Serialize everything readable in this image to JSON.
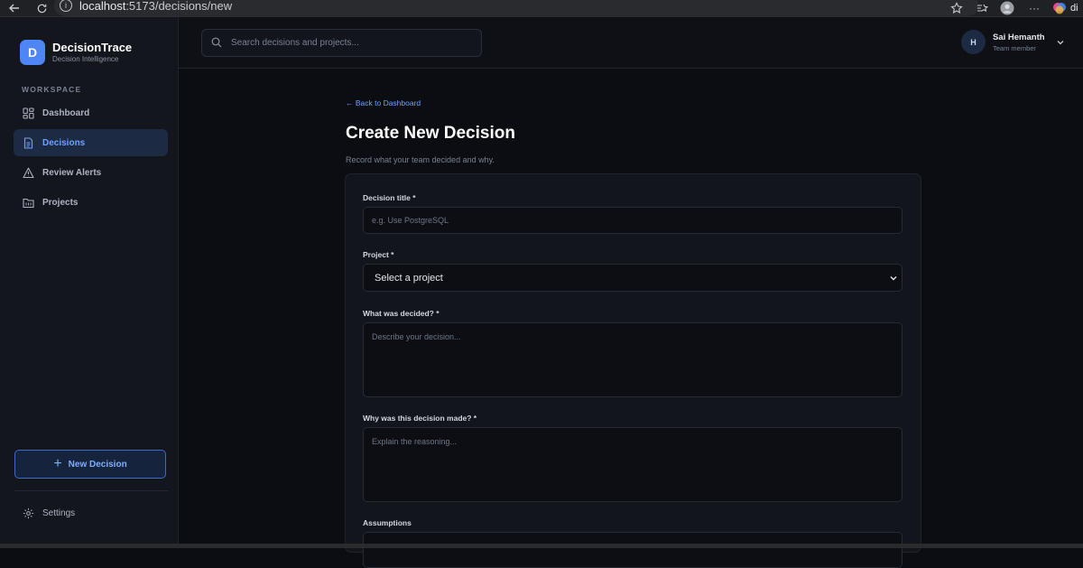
{
  "browser": {
    "url_host": "localhost",
    "url_path": ":5173/decisions/new",
    "partial_text": "di"
  },
  "brand": {
    "logo_letter": "D",
    "name": "DecisionTrace",
    "subtitle": "Decision Intelligence",
    "accent_color": "#4f86f7"
  },
  "sidebar": {
    "section_label": "WORKSPACE",
    "items": [
      {
        "label": "Dashboard",
        "icon": "dashboard-grid-icon",
        "active": false
      },
      {
        "label": "Decisions",
        "icon": "document-icon",
        "active": true
      },
      {
        "label": "Review Alerts",
        "icon": "alert-triangle-icon",
        "active": false
      },
      {
        "label": "Projects",
        "icon": "folder-icon",
        "active": false
      }
    ],
    "new_decision_button": "New Decision",
    "settings_label": "Settings"
  },
  "header": {
    "search_placeholder": "Search decisions and projects...",
    "user": {
      "initial": "H",
      "name": "Sai Hemanth",
      "role": "Team member"
    }
  },
  "main": {
    "back_link": "← Back to Dashboard",
    "title": "Create New Decision",
    "subtitle": "Record what your team decided and why.",
    "form": {
      "title_label": "Decision title *",
      "title_placeholder": "e.g. Use PostgreSQL",
      "project_label": "Project *",
      "project_selected": "Select a project",
      "decided_label": "What was decided? *",
      "decided_placeholder": "Describe your decision...",
      "why_label": "Why was this decision made? *",
      "why_placeholder": "Explain the reasoning...",
      "assumptions_label": "Assumptions"
    }
  }
}
